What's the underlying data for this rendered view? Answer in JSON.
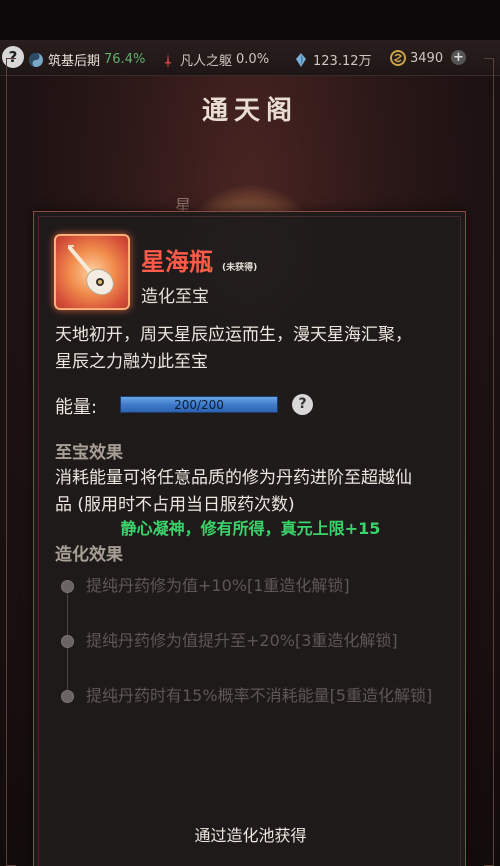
{
  "status_bar": {
    "realm_label": "筑基后期",
    "realm_percent": "76.4%",
    "body_label": "凡人之躯",
    "body_percent": "0.0%",
    "spirit_stones": "123.12万",
    "currency": "3490",
    "help_glyph": "?",
    "plus_glyph": "+"
  },
  "background": {
    "title": "通天阁",
    "side_char": "星"
  },
  "item": {
    "name": "星海瓶",
    "status": "(未获得)",
    "type": "造化至宝",
    "icon": "lute-bottle-icon",
    "description_line1": "天地初开，周天星辰应运而生，漫天星海汇聚，",
    "description_line2": "星辰之力融为此至宝"
  },
  "energy": {
    "label": "能量:",
    "value": "200/200",
    "fill_fraction": 1.0,
    "help_glyph": "?"
  },
  "treasure_effect": {
    "title": "至宝效果",
    "line1": "消耗能量可将任意品质的修为丹药进阶至超越仙",
    "line2": "品 (服用时不占用当日服药次数)",
    "bonus": "静心凝神，修有所得，真元上限+15"
  },
  "creation_effect": {
    "title": "造化效果",
    "items": [
      {
        "text": "提纯丹药修为值+10%[1重造化解锁]"
      },
      {
        "text": "提纯丹药修为值提升至+20%[3重造化解锁]"
      },
      {
        "text": "提纯丹药时有15%概率不消耗能量[5重造化解锁]"
      }
    ]
  },
  "acquire_hint": "通过造化池获得",
  "colors": {
    "item_name": "#ff5a4a",
    "bonus": "#3bd46a",
    "energy_bar": "#3c78c8",
    "modal_border": "#8a4b44"
  }
}
